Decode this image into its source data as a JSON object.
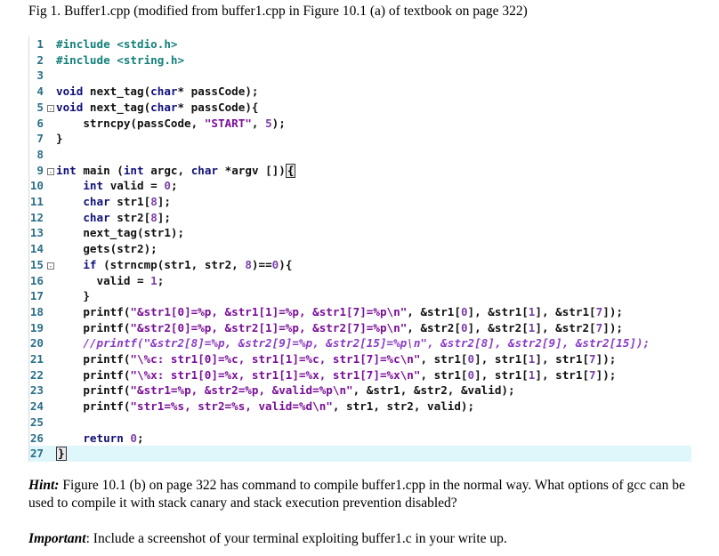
{
  "caption": "Fig 1. Buffer1.cpp (modified from buffer1.cpp in Figure 10.1 (a) of textbook on page 322)",
  "code_lines": [
    {
      "n": "1",
      "segments": [
        {
          "t": "#include <stdio.h>",
          "c": "pp"
        }
      ]
    },
    {
      "n": "2",
      "segments": [
        {
          "t": "#include <string.h>",
          "c": "pp"
        }
      ]
    },
    {
      "n": "3",
      "segments": []
    },
    {
      "n": "4",
      "segments": [
        {
          "t": "void ",
          "c": "kw"
        },
        {
          "t": "next_tag(",
          "c": "fn"
        },
        {
          "t": "char",
          "c": "kw"
        },
        {
          "t": "* passCode);",
          "c": "fn"
        }
      ]
    },
    {
      "n": "5",
      "fold": "-",
      "segments": [
        {
          "t": "void ",
          "c": "kw"
        },
        {
          "t": "next_tag(",
          "c": "fn"
        },
        {
          "t": "char",
          "c": "kw"
        },
        {
          "t": "* passCode){",
          "c": "fn"
        }
      ]
    },
    {
      "n": "6",
      "segments": [
        {
          "t": "    strncpy(passCode, ",
          "c": "fn"
        },
        {
          "t": "\"START\"",
          "c": "str"
        },
        {
          "t": ", ",
          "c": "fn"
        },
        {
          "t": "5",
          "c": "num"
        },
        {
          "t": ");",
          "c": "fn"
        }
      ]
    },
    {
      "n": "7",
      "segments": [
        {
          "t": "}",
          "c": "fn"
        }
      ]
    },
    {
      "n": "8",
      "segments": []
    },
    {
      "n": "9",
      "fold": "-",
      "segments": [
        {
          "t": "int ",
          "c": "kw"
        },
        {
          "t": "main (",
          "c": "fn"
        },
        {
          "t": "int ",
          "c": "kw"
        },
        {
          "t": "argc, ",
          "c": "fn"
        },
        {
          "t": "char ",
          "c": "kw"
        },
        {
          "t": "*argv [])",
          "c": "fn"
        },
        {
          "t": "{",
          "c": "box"
        }
      ]
    },
    {
      "n": "10",
      "segments": [
        {
          "t": "    ",
          "c": "fn"
        },
        {
          "t": "int ",
          "c": "kw"
        },
        {
          "t": "valid = ",
          "c": "fn"
        },
        {
          "t": "0",
          "c": "num"
        },
        {
          "t": ";",
          "c": "fn"
        }
      ]
    },
    {
      "n": "11",
      "segments": [
        {
          "t": "    ",
          "c": "fn"
        },
        {
          "t": "char ",
          "c": "kw"
        },
        {
          "t": "str1[",
          "c": "fn"
        },
        {
          "t": "8",
          "c": "num"
        },
        {
          "t": "];",
          "c": "fn"
        }
      ]
    },
    {
      "n": "12",
      "segments": [
        {
          "t": "    ",
          "c": "fn"
        },
        {
          "t": "char ",
          "c": "kw"
        },
        {
          "t": "str2[",
          "c": "fn"
        },
        {
          "t": "8",
          "c": "num"
        },
        {
          "t": "];",
          "c": "fn"
        }
      ]
    },
    {
      "n": "13",
      "segments": [
        {
          "t": "    next_tag(str1);",
          "c": "fn"
        }
      ]
    },
    {
      "n": "14",
      "segments": [
        {
          "t": "    gets(str2);",
          "c": "fn"
        }
      ]
    },
    {
      "n": "15",
      "fold": "-",
      "segments": [
        {
          "t": "    ",
          "c": "fn"
        },
        {
          "t": "if ",
          "c": "kw"
        },
        {
          "t": "(strncmp(str1, str2, ",
          "c": "fn"
        },
        {
          "t": "8",
          "c": "num"
        },
        {
          "t": ")==",
          "c": "fn"
        },
        {
          "t": "0",
          "c": "num"
        },
        {
          "t": "){",
          "c": "fn"
        }
      ]
    },
    {
      "n": "16",
      "segments": [
        {
          "t": "      valid = ",
          "c": "fn"
        },
        {
          "t": "1",
          "c": "num"
        },
        {
          "t": ";",
          "c": "fn"
        }
      ]
    },
    {
      "n": "17",
      "segments": [
        {
          "t": "    }",
          "c": "fn"
        }
      ]
    },
    {
      "n": "18",
      "segments": [
        {
          "t": "    printf(",
          "c": "fn"
        },
        {
          "t": "\"&str1[0]=%p, &str1[1]=%p, &str1[7]=%p\\n\"",
          "c": "str"
        },
        {
          "t": ", &str1[",
          "c": "fn"
        },
        {
          "t": "0",
          "c": "num"
        },
        {
          "t": "], &str1[",
          "c": "fn"
        },
        {
          "t": "1",
          "c": "num"
        },
        {
          "t": "], &str1[",
          "c": "fn"
        },
        {
          "t": "7",
          "c": "num"
        },
        {
          "t": "]);",
          "c": "fn"
        }
      ]
    },
    {
      "n": "19",
      "segments": [
        {
          "t": "    printf(",
          "c": "fn"
        },
        {
          "t": "\"&str2[0]=%p, &str2[1]=%p, &str2[7]=%p\\n\"",
          "c": "str"
        },
        {
          "t": ", &str2[",
          "c": "fn"
        },
        {
          "t": "0",
          "c": "num"
        },
        {
          "t": "], &str2[",
          "c": "fn"
        },
        {
          "t": "1",
          "c": "num"
        },
        {
          "t": "], &str2[",
          "c": "fn"
        },
        {
          "t": "7",
          "c": "num"
        },
        {
          "t": "]);",
          "c": "fn"
        }
      ]
    },
    {
      "n": "20",
      "segments": [
        {
          "t": "    //printf(\"&str2[8]=%p, &str2[9]=%p, &str2[15]=%p\\n\", &str2[8], &str2[9], &str2[15]);",
          "c": "cmt"
        }
      ]
    },
    {
      "n": "21",
      "segments": [
        {
          "t": "    printf(",
          "c": "fn"
        },
        {
          "t": "\"\\%c: str1[0]=%c, str1[1]=%c, str1[7]=%c\\n\"",
          "c": "str"
        },
        {
          "t": ", str1[",
          "c": "fn"
        },
        {
          "t": "0",
          "c": "num"
        },
        {
          "t": "], str1[",
          "c": "fn"
        },
        {
          "t": "1",
          "c": "num"
        },
        {
          "t": "], str1[",
          "c": "fn"
        },
        {
          "t": "7",
          "c": "num"
        },
        {
          "t": "]);",
          "c": "fn"
        }
      ]
    },
    {
      "n": "22",
      "segments": [
        {
          "t": "    printf(",
          "c": "fn"
        },
        {
          "t": "\"\\%x: str1[0]=%x, str1[1]=%x, str1[7]=%x\\n\"",
          "c": "str"
        },
        {
          "t": ", str1[",
          "c": "fn"
        },
        {
          "t": "0",
          "c": "num"
        },
        {
          "t": "], str1[",
          "c": "fn"
        },
        {
          "t": "1",
          "c": "num"
        },
        {
          "t": "], str1[",
          "c": "fn"
        },
        {
          "t": "7",
          "c": "num"
        },
        {
          "t": "]);",
          "c": "fn"
        }
      ]
    },
    {
      "n": "23",
      "segments": [
        {
          "t": "    printf(",
          "c": "fn"
        },
        {
          "t": "\"&str1=%p, &str2=%p, &valid=%p\\n\"",
          "c": "str"
        },
        {
          "t": ", &str1, &str2, &valid);",
          "c": "fn"
        }
      ]
    },
    {
      "n": "24",
      "segments": [
        {
          "t": "    printf(",
          "c": "fn"
        },
        {
          "t": "\"str1=%s, str2=%s, valid=%d\\n\"",
          "c": "str"
        },
        {
          "t": ", str1, str2, valid);",
          "c": "fn"
        }
      ]
    },
    {
      "n": "25",
      "segments": []
    },
    {
      "n": "26",
      "segments": [
        {
          "t": "    ",
          "c": "fn"
        },
        {
          "t": "return ",
          "c": "kw"
        },
        {
          "t": "0",
          "c": "num"
        },
        {
          "t": ";",
          "c": "fn"
        }
      ]
    },
    {
      "n": "27",
      "current": true,
      "segments": [
        {
          "t": "}",
          "c": "box"
        }
      ]
    }
  ],
  "hint": {
    "label": "Hint:",
    "text": " Figure 10.1 (b) on page 322 has command to compile buffer1.cpp in the normal way. What options of gcc can be used  to compile it with stack canary and stack execution prevention disabled?"
  },
  "important": {
    "label": "Important",
    "text": ": Include a screenshot of your terminal exploiting buffer1.c in your write up."
  }
}
